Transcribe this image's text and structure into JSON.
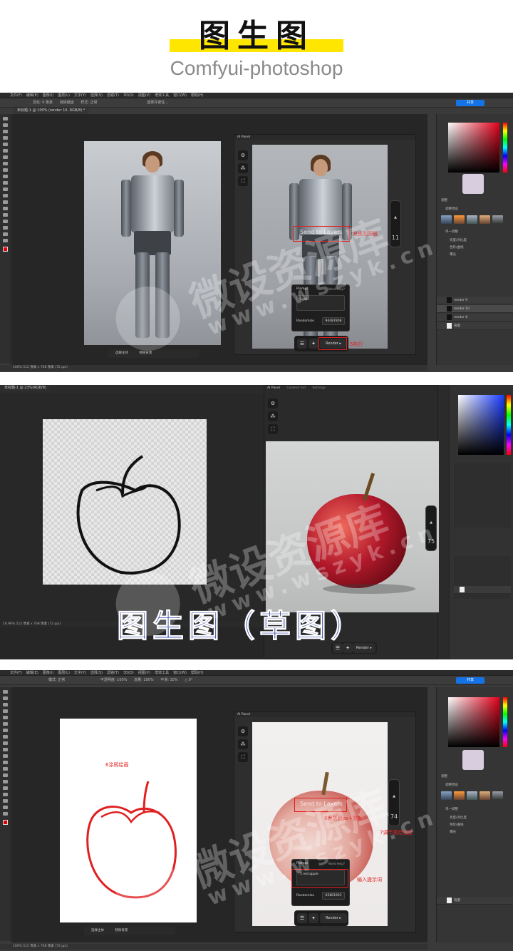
{
  "header": {
    "title": "图生图",
    "subtitle": "Comfyui-photoshop"
  },
  "ps": {
    "menu": [
      "文件(F)",
      "编辑(E)",
      "图像(I)",
      "图层(L)",
      "文字(Y)",
      "选择(S)",
      "滤镜(T)",
      "3D(D)",
      "视图(V)",
      "增效工具",
      "窗口(W)",
      "帮助(H)"
    ],
    "share_label": "共享",
    "shot1_tab": "未标题-1 @ 100% (render 10, RGB/8) *",
    "shot1_status": "100%   512 像素 x 768 像素 (72 ppi)",
    "shot2_tab": "未标题-1 @ 23%(RGB/8)",
    "shot2_status": "16.96%   512 像素 x 768 像素 (72 ppi)",
    "shot3_status": "100%   512 像素 x 768 像素 (72 ppi)",
    "opt1": [
      "羽化: 0 像素",
      "消除锯齿",
      "样式: 正常",
      "选择并遮住..."
    ],
    "opt3": [
      "模式: 正常",
      "不透明度: 100%",
      "流量: 100%",
      "平滑: 10%",
      "△ 0°"
    ],
    "ctx_select_subject": "选择主体",
    "ctx_remove_bg": "移除背景",
    "layers1": [
      "render 9",
      "render 10",
      "render 8",
      "背景"
    ],
    "layers3": [
      "背景"
    ],
    "panel_labels": {
      "adjust": "调整",
      "presets": "调整预设",
      "single": "单一调整",
      "brightness": "亮度/对比度",
      "levels": "色阶/曲线",
      "exposure": "曝光"
    }
  },
  "ai": {
    "panel_title": "AI Panel",
    "prompt_title": "Prompt",
    "help_label": "Need Help?",
    "randomize_label": "Randomize",
    "render_label": "Render ▸",
    "send_to_layers": "Send to Layers",
    "shot1": {
      "prompt": "1girl",
      "seed": "94487808",
      "slider": "11"
    },
    "shot2": {
      "slider": "75"
    },
    "shot3": {
      "prompt": "1 red apple",
      "seed": "K5861901",
      "slider": "74"
    },
    "tabs2": [
      "AI Panel",
      "Content Aid",
      "Settings"
    ]
  },
  "annotations": {
    "shot1_render": "5执行",
    "shot1_send": "发送到图层",
    "shot2_caption": "图生图（草图）",
    "shot3_draw": "6涂鸦绘画",
    "shot3_send": "8发送到ps+重新",
    "shot3_slider": "7调节重绘强度",
    "shot3_prompt": "输入提示词"
  },
  "colors": {
    "accent_red": "#e02020",
    "highlight_yellow": "#ffe600",
    "caption_blue": "#1c2f9c",
    "share_blue": "#1473e6"
  },
  "watermark": {
    "big": "微设资源库",
    "small": "www.wszyk.cn"
  }
}
